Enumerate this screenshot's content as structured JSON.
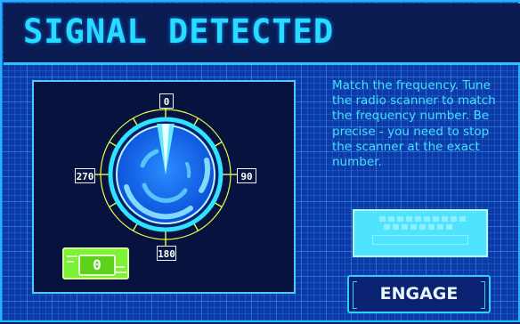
{
  "header": {
    "title": "SIGNAL DETECTED"
  },
  "dial": {
    "labels": {
      "top": "0",
      "right": "90",
      "bottom": "180",
      "left": "270"
    },
    "needle_angle_deg": 0
  },
  "counter": {
    "value": "0"
  },
  "instructions": {
    "text": "Match the frequency. Tune the radio scanner to match the frequency number. Be precise - you need to stop the scanner at the exact number."
  },
  "engage_button": {
    "label": "ENGAGE"
  },
  "colors": {
    "accent": "#27dcff",
    "panel": "#07123f",
    "counter_green": "#7cf236",
    "grid_blue": "#0c3aa8"
  },
  "icons": {
    "keyboard": "keyboard-icon",
    "dial": "radar-dial-icon"
  }
}
